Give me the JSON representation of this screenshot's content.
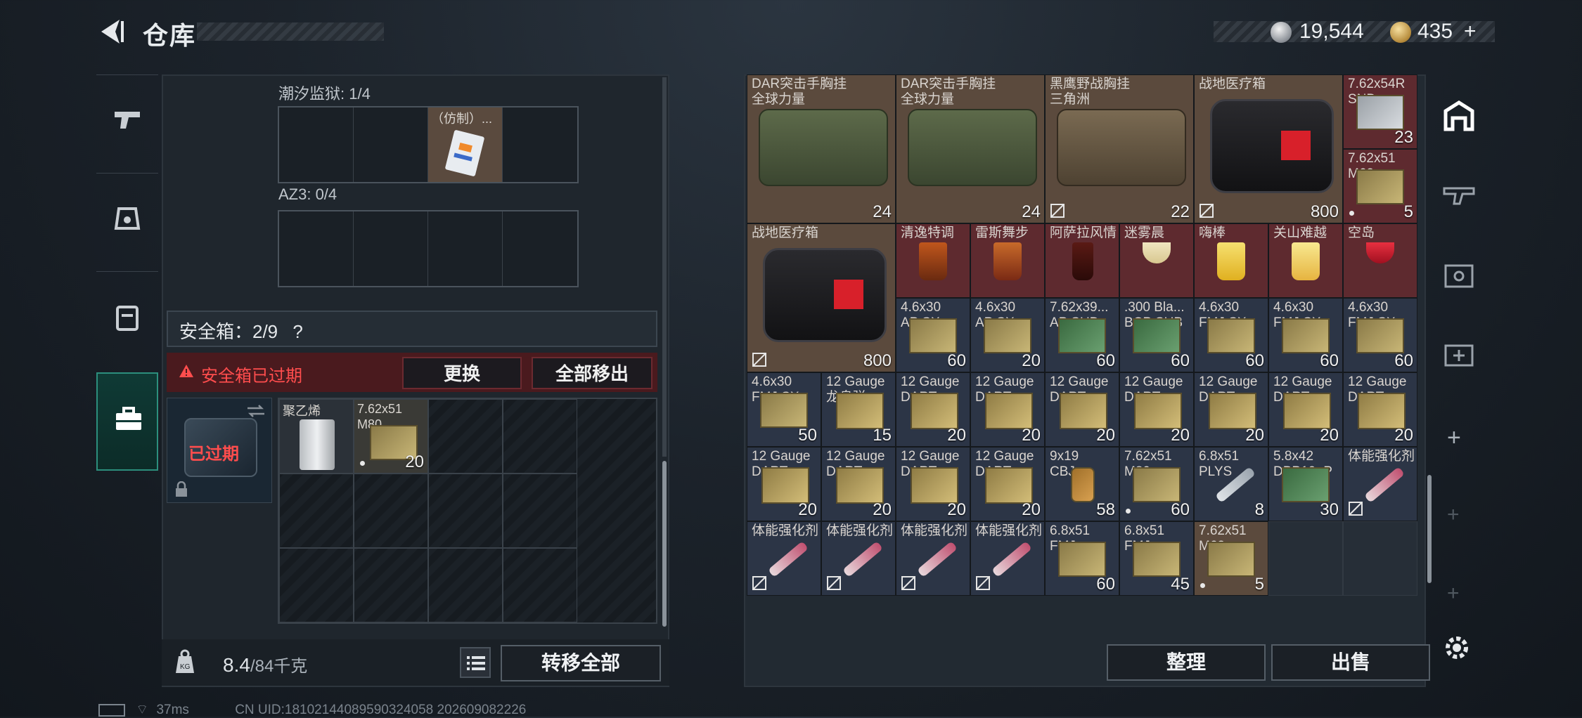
{
  "header": {
    "title": "仓库"
  },
  "currency": {
    "silver": "19,544",
    "gold": "435",
    "gold_plus": "+"
  },
  "left": {
    "prison_label": "潮汐监狱: 1/4",
    "prison_item": "（仿制）...",
    "az3_label": "AZ3: 0/4",
    "safe_box_title": "安全箱：2/9",
    "safe_help": "?",
    "expired_warning": "安全箱已过期",
    "replace_btn": "更换",
    "remove_all_btn": "全部移出",
    "expired_tag": "已过期",
    "safe_items": [
      {
        "name": "聚乙烯",
        "count": ""
      },
      {
        "name": "7.62x51 M80",
        "count": "20"
      }
    ],
    "weight": "8.4",
    "weight_cap": "/84千克",
    "transfer_all_btn": "转移全部"
  },
  "status": {
    "ping": "37ms",
    "uid": "CN UID:18102144089590324058 202609082226"
  },
  "right": {
    "sort_btn": "整理",
    "sell_btn": "出售",
    "items": {
      "r0": [
        {
          "name": "DAR突击手胸挂\n全球力量",
          "count": "24"
        },
        {
          "name": "DAR突击手胸挂\n全球力量",
          "count": "24"
        },
        {
          "name": "黑鹰野战胸挂\n三角洲",
          "count": "22"
        },
        {
          "name": "战地医疗箱",
          "count": "800"
        },
        {
          "name": "7.62x54R\nSNB",
          "count": "23"
        },
        {
          "name": "7.62x51\nM62",
          "count": "5"
        }
      ],
      "r1": [
        {
          "name": "战地医疗箱",
          "count": "800"
        },
        {
          "name": "清逸特调"
        },
        {
          "name": "雷斯舞步"
        },
        {
          "name": "阿萨拉风情"
        },
        {
          "name": "迷雾晨"
        },
        {
          "name": "嗨棒"
        },
        {
          "name": "关山难越"
        },
        {
          "name": "空岛"
        }
      ],
      "r2": [
        {
          "name": "4.6x30\nAP SX",
          "count": "60"
        },
        {
          "name": "4.6x30\nAP SX",
          "count": "20"
        },
        {
          "name": "7.62x39...\nAP SUB",
          "count": "60"
        },
        {
          "name": ".300 Bla...\nBCP SUB",
          "count": "60"
        },
        {
          "name": "4.6x30\nFMJ SX",
          "count": "60"
        },
        {
          "name": "4.6x30\nFMJ SX",
          "count": "60"
        },
        {
          "name": "4.6x30\nFMJ SX",
          "count": "60"
        }
      ],
      "r3": [
        {
          "name": "4.6x30\nFMJ SX",
          "count": "50"
        },
        {
          "name": "12 Gauge\n龙息弹",
          "count": "15"
        },
        {
          "name": "12 Gauge\nDART",
          "count": "20"
        },
        {
          "name": "12 Gauge\nDART",
          "count": "20"
        },
        {
          "name": "12 Gauge\nDART",
          "count": "20"
        },
        {
          "name": "12 Gauge\nDART",
          "count": "20"
        },
        {
          "name": "12 Gauge\nDART",
          "count": "20"
        },
        {
          "name": "12 Gauge\nDART",
          "count": "20"
        },
        {
          "name": "12 Gauge\nDART",
          "count": "20"
        }
      ],
      "r4": [
        {
          "name": "12 Gauge\nDART",
          "count": "20"
        },
        {
          "name": "12 Gauge\nDART",
          "count": "20"
        },
        {
          "name": "12 Gauge\nDART",
          "count": "20"
        },
        {
          "name": "12 Gauge\nDART",
          "count": "20"
        },
        {
          "name": "9x19\nCBJ",
          "count": "58"
        },
        {
          "name": "7.62x51\nM80",
          "count": "60"
        },
        {
          "name": "6.8x51\nPLYS",
          "count": "8"
        },
        {
          "name": "5.8x42\nDBP10+P",
          "count": "30"
        },
        {
          "name": "体能强化剂"
        }
      ],
      "r5": [
        {
          "name": "体能强化剂"
        },
        {
          "name": "体能强化剂"
        },
        {
          "name": "体能强化剂"
        },
        {
          "name": "体能强化剂"
        },
        {
          "name": "6.8x51\nFMJ",
          "count": "60"
        },
        {
          "name": "6.8x51\nFMJ",
          "count": "45"
        },
        {
          "name": "7.62x51\nM62",
          "count": "5"
        }
      ]
    }
  }
}
